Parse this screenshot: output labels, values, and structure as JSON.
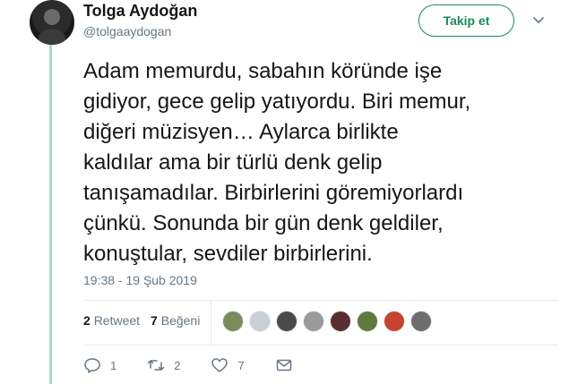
{
  "author": {
    "display_name": "Tolga Aydoğan",
    "handle": "@tolgaaydogan"
  },
  "follow_button_label": "Takip et",
  "tweet": {
    "lines": [
      "Adam memurdu, sabahın köründe işe",
      "gidiyor, gece gelip yatıyordu. Biri memur,",
      "diğeri müzisyen… Aylarca birlikte",
      "kaldılar ama bir türlü denk gelip",
      "tanışamadılar. Birbirlerini göremiyorlardı",
      "çünkü. Sonunda bir gün denk geldiler,",
      "konuştular, sevdiler birbirlerini."
    ],
    "timestamp": "19:38 - 19 Şub 2019"
  },
  "stats": {
    "retweet_count": "2",
    "retweet_label": "Retweet",
    "like_count": "7",
    "like_label": "Beğeni"
  },
  "likers": [
    {
      "color": "#7a8c5a",
      "icon": "landscape-avatar"
    },
    {
      "color": "#c9cfd4",
      "icon": "default-avatar"
    },
    {
      "color": "#4a4a4a",
      "icon": "group-avatar"
    },
    {
      "color": "#9a9a9a",
      "icon": "portrait-avatar"
    },
    {
      "color": "#5a2e2e",
      "icon": "portrait-avatar"
    },
    {
      "color": "#5e7a3c",
      "icon": "nature-avatar"
    },
    {
      "color": "#c4442f",
      "icon": "flag-avatar"
    },
    {
      "color": "#6e6e6e",
      "icon": "portrait-avatar"
    }
  ],
  "actions": {
    "reply_count": "1",
    "retweet_count": "2",
    "like_count": "7"
  },
  "colors": {
    "accent": "#1b8a5a",
    "thread_line": "#a8dcc4",
    "secondary_text": "#657786"
  }
}
